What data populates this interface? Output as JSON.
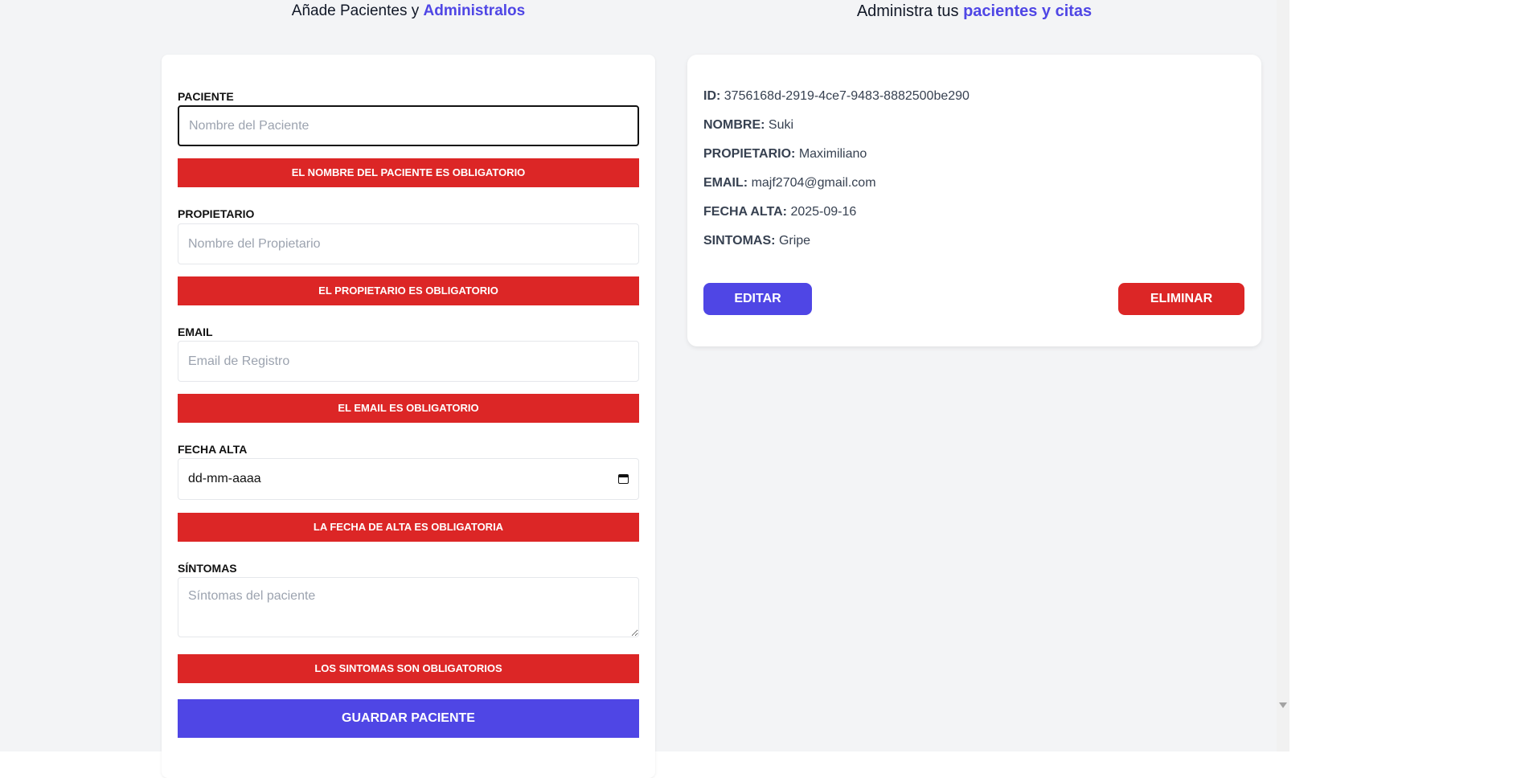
{
  "form_header": {
    "prefix": "Añade Pacientes y",
    "accent": "Administralos"
  },
  "list_header": {
    "prefix": "Administra tus",
    "accent": "pacientes y citas"
  },
  "form": {
    "paciente": {
      "label": "Paciente",
      "placeholder": "Nombre del Paciente",
      "value": "",
      "error": "El nombre del paciente es obligatorio"
    },
    "propietario": {
      "label": "Propietario",
      "placeholder": "Nombre del Propietario",
      "value": "",
      "error": "El propietario es obligatorio"
    },
    "email": {
      "label": "Email",
      "placeholder": "Email de Registro",
      "value": "",
      "error": "El email es obligatorio"
    },
    "fecha_alta": {
      "label": "Fecha Alta",
      "placeholder": "dd-mm-aaaa",
      "error": "La fecha de alta es obligatoria"
    },
    "sintomas": {
      "label": "Síntomas",
      "placeholder": "Síntomas del paciente",
      "value": "",
      "error": "Los sintomas son obligatorios"
    },
    "submit_label": "Guardar Paciente"
  },
  "patient": {
    "id_label": "ID:",
    "id": "3756168d-2919-4ce7-9483-8882500be290",
    "nombre_label": "Nombre:",
    "nombre": "Suki",
    "propietario_label": "Propietario:",
    "propietario": "Maximiliano",
    "email_label": "Email:",
    "email": "majf2704@gmail.com",
    "fecha_label": "Fecha Alta:",
    "fecha": "2025-09-16",
    "sintomas_label": "Sintomas:",
    "sintomas": "Gripe",
    "edit_label": "Editar",
    "delete_label": "Eliminar"
  },
  "colors": {
    "accent": "#4f46e5",
    "error": "#dc2626",
    "background": "#f3f4f6"
  },
  "icons": {
    "date": "calendar-icon",
    "scroll": "scroll-down-arrow-icon"
  }
}
